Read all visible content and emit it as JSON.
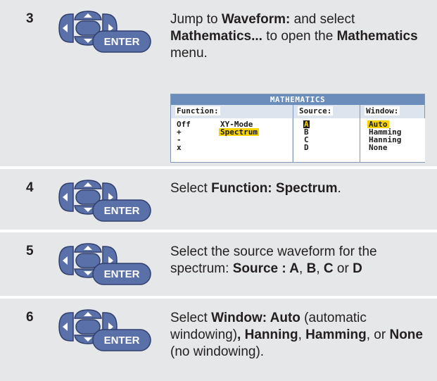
{
  "steps": [
    {
      "number": "3",
      "parts": [
        {
          "t": "Jump to ",
          "b": false
        },
        {
          "t": "Waveform:",
          "b": true
        },
        {
          "t": " and select ",
          "b": false
        },
        {
          "t": "Mathematics...",
          "b": true
        },
        {
          "t": " to open the ",
          "b": false
        },
        {
          "t": "Mathematics",
          "b": true
        },
        {
          "t": " menu.",
          "b": false
        }
      ]
    },
    {
      "number": "4",
      "parts": [
        {
          "t": "Select ",
          "b": false
        },
        {
          "t": "Function: Spectrum",
          "b": true
        },
        {
          "t": ".",
          "b": false
        }
      ]
    },
    {
      "number": "5",
      "parts": [
        {
          "t": "Select the source waveform for the spectrum: ",
          "b": false
        },
        {
          "t": "Source : A",
          "b": true
        },
        {
          "t": ", ",
          "b": false
        },
        {
          "t": "B",
          "b": true
        },
        {
          "t": ", ",
          "b": false
        },
        {
          "t": "C",
          "b": true
        },
        {
          "t": " or ",
          "b": false
        },
        {
          "t": "D",
          "b": true
        }
      ]
    },
    {
      "number": "6",
      "parts": [
        {
          "t": "Select ",
          "b": false
        },
        {
          "t": "Window: Auto",
          "b": true
        },
        {
          "t": " (automatic windowing)",
          "b": false
        },
        {
          "t": ", Hanning",
          "b": true
        },
        {
          "t": ", ",
          "b": false
        },
        {
          "t": "Hamming",
          "b": true
        },
        {
          "t": ", or ",
          "b": false
        },
        {
          "t": "None",
          "b": true
        },
        {
          "t": " (no windowing).",
          "b": false
        }
      ]
    }
  ],
  "keypad": {
    "enter_label": "ENTER"
  },
  "menu": {
    "title": "MATHEMATICS",
    "function": {
      "header": "Function:",
      "col1": [
        "Off",
        "+",
        "-",
        "x"
      ],
      "col2": [
        "XY-Mode",
        "Spectrum"
      ],
      "selected": "Spectrum"
    },
    "source": {
      "header": "Source:",
      "items": [
        "A",
        "B",
        "C",
        "D"
      ],
      "cursor": "A"
    },
    "window": {
      "header": "Window:",
      "items": [
        "Auto",
        "Hamming",
        "Hanning",
        "None"
      ],
      "selected": "Auto"
    }
  },
  "colors": {
    "step_background": "#e6e7e8",
    "button_blue": "#5a70a8",
    "menu_title_blue": "#6a8dbb",
    "highlight_yellow": "#f7d300"
  }
}
